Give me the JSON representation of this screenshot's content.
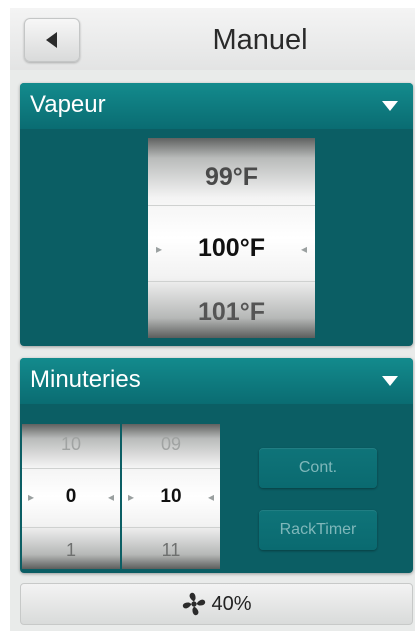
{
  "header": {
    "title": "Manuel"
  },
  "vapeur": {
    "title": "Vapeur",
    "temperatures": [
      "99°F",
      "100°F",
      "101°F"
    ]
  },
  "minuteries": {
    "title": "Minuteries",
    "minutes": [
      "10",
      "0",
      "1"
    ],
    "seconds": [
      "09",
      "10",
      "11"
    ],
    "cont_label": "Cont.",
    "racktimer_label": "RackTimer"
  },
  "fan": {
    "label": "40%",
    "icon": "fan-icon"
  },
  "colors": {
    "panel": "#0b5e64",
    "panel_head": "#138b8d",
    "button_text": "#7fb7ba"
  }
}
